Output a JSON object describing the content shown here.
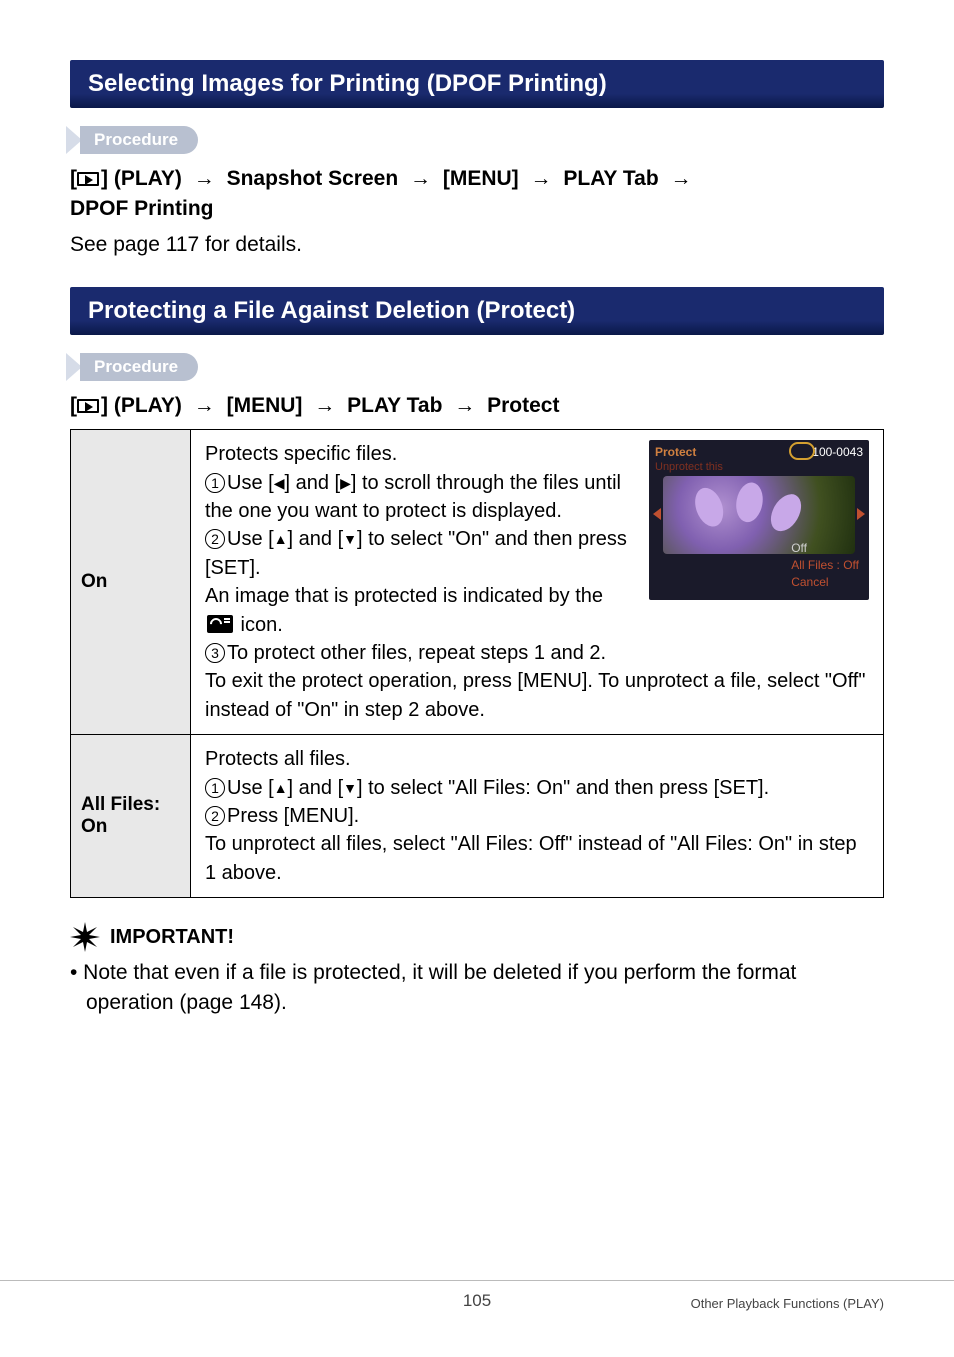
{
  "section1": {
    "title": "Selecting Images for Printing (DPOF Printing)",
    "procedure_label": "Procedure",
    "breadcrumb_prefix": "[",
    "breadcrumb_play": "] (PLAY)",
    "arrow": "→",
    "bc_snapshot": "Snapshot Screen",
    "bc_menu": "[MENU]",
    "bc_playtab": "PLAY Tab",
    "bc_last": "DPOF Printing",
    "body": "See page 117 for details."
  },
  "section2": {
    "title": "Protecting a File Against Deletion (Protect)",
    "procedure_label": "Procedure",
    "bc_play": "] (PLAY)",
    "bc_menu": "[MENU]",
    "bc_playtab": "PLAY Tab",
    "bc_last": "Protect"
  },
  "table": {
    "row1": {
      "label": "On",
      "intro": "Protects specific files.",
      "s1a": "Use [",
      "s1b": "] and [",
      "s1c": "] to scroll through the files until the one you want to protect is displayed.",
      "s2a": "Use [",
      "s2b": "] and [",
      "s2c": "] to select \"On\" and then press [SET].",
      "s2d": "An image that is protected is indicated by the ",
      "s2e": " icon.",
      "s3": "To protect other files, repeat steps 1 and 2.",
      "outro": "To exit the protect operation, press [MENU]. To unprotect a file, select \"Off\" instead of \"On\" in step 2 above."
    },
    "row2": {
      "label": "All Files: On",
      "intro": "Protects all files.",
      "s1a": "Use [",
      "s1b": "] and [",
      "s1c": "] to select \"All Files: On\" and then press [SET].",
      "s2": "Press [MENU].",
      "outro": "To unprotect all files, select \"All Files: Off\" instead of \"All Files: On\" in step 1 above."
    }
  },
  "screenshot": {
    "protect": "Protect",
    "id": "100-0043",
    "sub": "Unprotect this",
    "off": "Off",
    "allfiles": "All Files : Off",
    "cancel": "Cancel"
  },
  "important": {
    "label": "IMPORTANT!",
    "text": "• Note that even if a file is protected, it will be deleted if you perform the format operation (page 148)."
  },
  "footer": {
    "page": "105",
    "right": "Other Playback Functions (PLAY)"
  }
}
